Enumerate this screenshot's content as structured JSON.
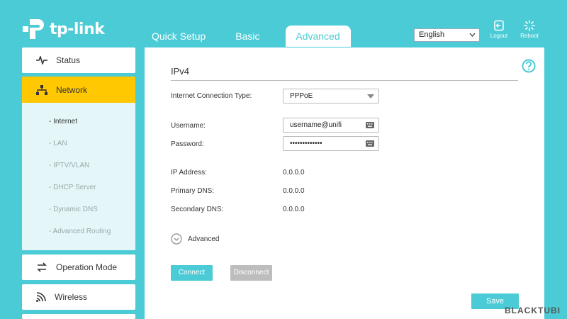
{
  "brand": {
    "name": "tp-link"
  },
  "nav": {
    "tabs": [
      {
        "label": "Quick Setup"
      },
      {
        "label": "Basic"
      },
      {
        "label": "Advanced",
        "active": true
      }
    ]
  },
  "header": {
    "language": "English",
    "logout_label": "Logout",
    "reboot_label": "Reboot"
  },
  "sidebar": {
    "items": [
      {
        "label": "Status",
        "icon": "pulse-icon"
      },
      {
        "label": "Network",
        "icon": "network-icon",
        "active": true
      },
      {
        "label": "Operation Mode",
        "icon": "swap-icon"
      },
      {
        "label": "Wireless",
        "icon": "wifi-icon"
      }
    ],
    "network_sub": [
      {
        "label": "- Internet",
        "active": true
      },
      {
        "label": "- LAN"
      },
      {
        "label": "- IPTV/VLAN"
      },
      {
        "label": "- DHCP Server"
      },
      {
        "label": "- Dynamic DNS"
      },
      {
        "label": "- Advanced Routing"
      }
    ]
  },
  "main": {
    "title": "IPv4",
    "connection_type_label": "Internet Connection Type:",
    "connection_type_value": "PPPoE",
    "username_label": "Username:",
    "username_value": "username@unifi",
    "password_label": "Password:",
    "password_value": "•••••••••••••",
    "ip_label": "IP Address:",
    "ip_value": "0.0.0.0",
    "primary_dns_label": "Primary DNS:",
    "primary_dns_value": "0.0.0.0",
    "secondary_dns_label": "Secondary DNS:",
    "secondary_dns_value": "0.0.0.0",
    "advanced_label": "Advanced",
    "connect_label": "Connect",
    "disconnect_label": "Disconnect",
    "save_label": "Save"
  },
  "watermark": "BLACKTUBI",
  "colors": {
    "accent": "#4acbd6",
    "active_nav": "#ffc800",
    "disabled": "#bdbdbd"
  }
}
